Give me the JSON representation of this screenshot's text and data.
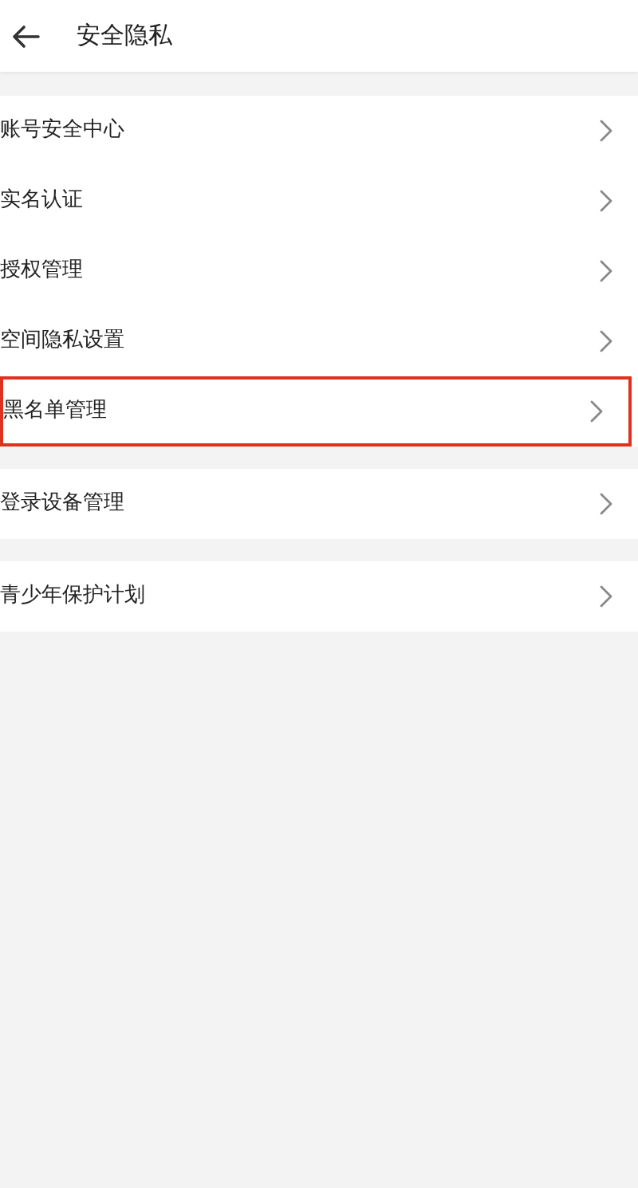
{
  "header": {
    "title": "安全隐私"
  },
  "groups": [
    {
      "items": [
        {
          "label": "账号安全中心",
          "highlighted": false
        },
        {
          "label": "实名认证",
          "highlighted": false
        },
        {
          "label": "授权管理",
          "highlighted": false
        },
        {
          "label": "空间隐私设置",
          "highlighted": false
        },
        {
          "label": "黑名单管理",
          "highlighted": true
        }
      ]
    },
    {
      "items": [
        {
          "label": "登录设备管理",
          "highlighted": false
        }
      ]
    },
    {
      "items": [
        {
          "label": "青少年保护计划",
          "highlighted": false
        }
      ]
    }
  ]
}
